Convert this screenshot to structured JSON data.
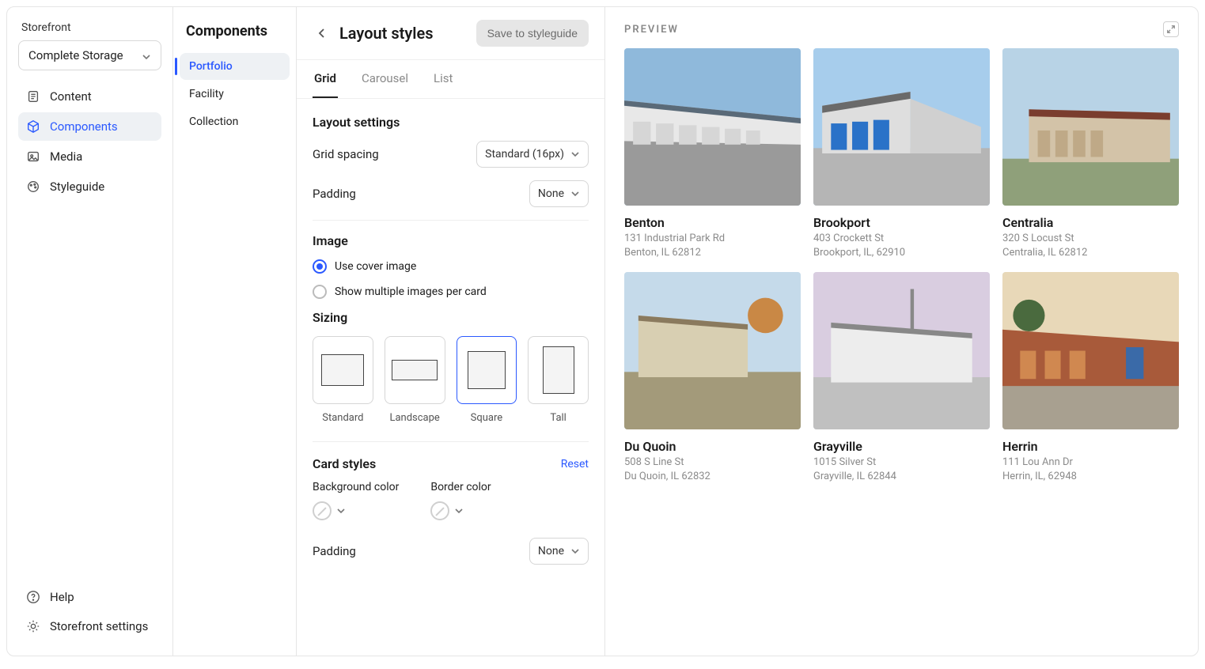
{
  "sidebar": {
    "brand": "Storefront",
    "selector": "Complete Storage",
    "nav": {
      "content": "Content",
      "components": "Components",
      "media": "Media",
      "styleguide": "Styleguide"
    },
    "help": "Help",
    "settings": "Storefront settings"
  },
  "components_panel": {
    "heading": "Components",
    "items": {
      "portfolio": "Portfolio",
      "facility": "Facility",
      "collection": "Collection"
    }
  },
  "editor": {
    "title": "Layout styles",
    "save_button": "Save to styleguide",
    "tabs": {
      "grid": "Grid",
      "carousel": "Carousel",
      "list": "List"
    },
    "layout_settings": {
      "heading": "Layout settings",
      "grid_spacing_label": "Grid spacing",
      "grid_spacing_value": "Standard (16px)",
      "padding_label": "Padding",
      "padding_value": "None"
    },
    "image": {
      "heading": "Image",
      "radio_cover": "Use cover image",
      "radio_multiple": "Show multiple images per card",
      "sizing_heading": "Sizing",
      "sizes": {
        "standard": "Standard",
        "landscape": "Landscape",
        "square": "Square",
        "tall": "Tall"
      }
    },
    "card_styles": {
      "heading": "Card styles",
      "reset": "Reset",
      "bg_label": "Background color",
      "border_label": "Border color",
      "padding_label": "Padding",
      "padding_value": "None"
    }
  },
  "preview": {
    "title": "PREVIEW",
    "cards": [
      {
        "name": "Benton",
        "line1": "131 Industrial Park Rd",
        "line2": "Benton, IL 62812"
      },
      {
        "name": "Brookport",
        "line1": "403 Crockett St",
        "line2": "Brookport, IL, 62910"
      },
      {
        "name": "Centralia",
        "line1": "320 S Locust St",
        "line2": "Centralia, IL 62812"
      },
      {
        "name": "Du Quoin",
        "line1": "508 S Line St",
        "line2": "Du Quoin, IL 62832"
      },
      {
        "name": "Grayville",
        "line1": "1015 Silver St",
        "line2": "Grayville, IL 62844"
      },
      {
        "name": "Herrin",
        "line1": "111 Lou Ann Dr",
        "line2": "Herrin, IL, 62948"
      }
    ]
  }
}
